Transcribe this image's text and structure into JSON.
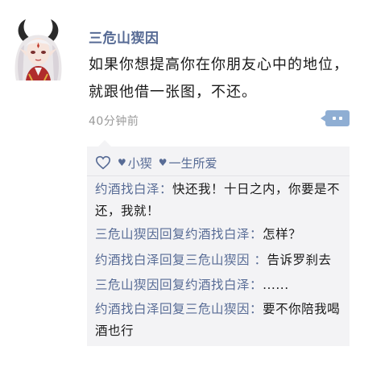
{
  "post": {
    "author": "三危山猰因",
    "content_lines": [
      "如果你想提高你在你朋友心中的地位，",
      "就跟他借一张图，不还。"
    ],
    "time": "40分钟前"
  },
  "likes": {
    "icon": "heart-outline-icon",
    "users": [
      "小猰",
      "一生所爱"
    ]
  },
  "comments": [
    {
      "author": "约酒找白泽",
      "reply_word": "",
      "reply_to": "",
      "sep": "：",
      "text": "快还我！十日之内，你要是不还，我就！"
    },
    {
      "author": "三危山猰因",
      "reply_word": "回复",
      "reply_to": "约酒找白泽",
      "sep": "：",
      "text": "怎样？"
    },
    {
      "author": "约酒找白泽",
      "reply_word": "回复",
      "reply_to": "三危山猰因",
      "sep": " ：",
      "text": "告诉罗刹去"
    },
    {
      "author": "三危山猰因",
      "reply_word": "回复",
      "reply_to": "约酒找白泽",
      "sep": "：",
      "text": "......"
    },
    {
      "author": "约酒找白泽",
      "reply_word": "回复",
      "reply_to": "三危山猰因",
      "sep": "：",
      "text": "要不你陪我喝酒也行"
    }
  ],
  "colors": {
    "name": "#576b95",
    "text": "#1a1a1a",
    "time": "#9a9a9a",
    "box": "#f3f3f5",
    "more_button": "#8faed3"
  }
}
